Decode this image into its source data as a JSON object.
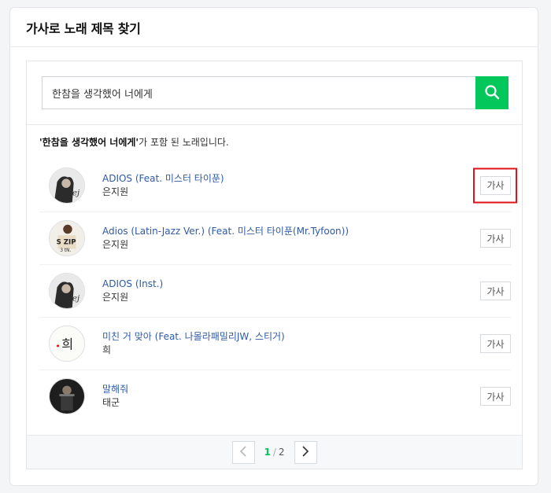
{
  "header": {
    "title": "가사로 노래 제목 찾기"
  },
  "search": {
    "value": "한참을 생각했어 너에게",
    "button_icon": "search-icon"
  },
  "result": {
    "query": "'한참을 생각했어 너에게'",
    "suffix": "가 포함 된 노래입니다."
  },
  "songs": [
    {
      "title": "ADIOS (Feat. 미스터 타이푼)",
      "artist": "은지원",
      "lyrics_label": "가사"
    },
    {
      "title": "Adios (Latin-Jazz Ver.) (Feat. 미스터 타이푼(Mr.Tyfoon))",
      "artist": "은지원",
      "lyrics_label": "가사"
    },
    {
      "title": "ADIOS (Inst.)",
      "artist": "은지원",
      "lyrics_label": "가사"
    },
    {
      "title": "미친 거 맞아 (Feat. 나몰라패밀리JW, 스티거)",
      "artist": "희",
      "lyrics_label": "가사"
    },
    {
      "title": "말해줘",
      "artist": "태군",
      "lyrics_label": "가사"
    }
  ],
  "pagination": {
    "current": "1",
    "total": "2"
  },
  "colors": {
    "accent": "#03c75a",
    "link": "#2e5aa8",
    "highlight": "#e0131c"
  }
}
